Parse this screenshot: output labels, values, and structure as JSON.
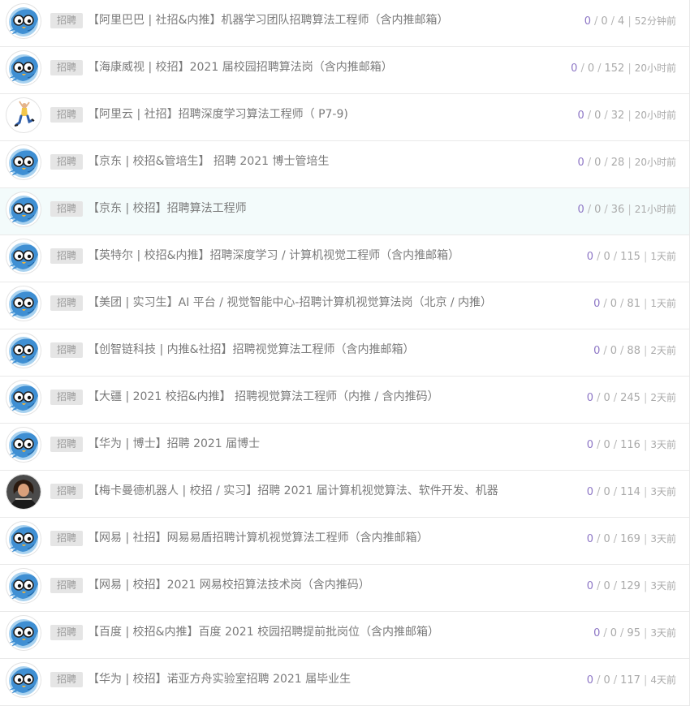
{
  "topics": [
    {
      "tag": "招聘",
      "title": "【阿里巴巴 | 社招&内推】机器学习团队招聘算法工程师（含内推邮箱）",
      "replies": "0",
      "likes": "0",
      "views": "4",
      "time": "52分钟前",
      "avatar": "bird-avatar-icon"
    },
    {
      "tag": "招聘",
      "title": "【海康威视 | 校招】2021 届校园招聘算法岗（含内推邮箱）",
      "replies": "0",
      "likes": "0",
      "views": "152",
      "time": "20小时前",
      "avatar": "bird-avatar-icon"
    },
    {
      "tag": "招聘",
      "title": "【阿里云 | 社招】招聘深度学习算法工程师（ P7-9)",
      "replies": "0",
      "likes": "0",
      "views": "32",
      "time": "20小时前",
      "avatar": "jumping-person-avatar-icon"
    },
    {
      "tag": "招聘",
      "title": "【京东 | 校招&管培生】 招聘 2021 博士管培生",
      "replies": "0",
      "likes": "0",
      "views": "28",
      "time": "20小时前",
      "avatar": "bird-avatar-icon"
    },
    {
      "tag": "招聘",
      "title": "【京东 | 校招】招聘算法工程师",
      "replies": "0",
      "likes": "0",
      "views": "36",
      "time": "21小时前",
      "avatar": "bird-avatar-icon"
    },
    {
      "tag": "招聘",
      "title": "【英特尔 | 校招&内推】招聘深度学习 / 计算机视觉工程师（含内推邮箱）",
      "replies": "0",
      "likes": "0",
      "views": "115",
      "time": "1天前",
      "avatar": "bird-avatar-icon"
    },
    {
      "tag": "招聘",
      "title": "【美团 | 实习生】AI 平台 / 视觉智能中心-招聘计算机视觉算法岗（北京 / 内推）",
      "replies": "0",
      "likes": "0",
      "views": "81",
      "time": "1天前",
      "avatar": "bird-avatar-icon"
    },
    {
      "tag": "招聘",
      "title": "【创智链科技 | 内推&社招】招聘视觉算法工程师（含内推邮箱）",
      "replies": "0",
      "likes": "0",
      "views": "88",
      "time": "2天前",
      "avatar": "bird-avatar-icon"
    },
    {
      "tag": "招聘",
      "title": "【大疆 | 2021 校招&内推】 招聘视觉算法工程师（内推 / 含内推码）",
      "replies": "0",
      "likes": "0",
      "views": "245",
      "time": "2天前",
      "avatar": "bird-avatar-icon"
    },
    {
      "tag": "招聘",
      "title": "【华为 | 博士】招聘 2021 届博士",
      "replies": "0",
      "likes": "0",
      "views": "116",
      "time": "3天前",
      "avatar": "bird-avatar-icon"
    },
    {
      "tag": "招聘",
      "title": "【梅卡曼德机器人 | 校招 / 实习】招聘 2021 届计算机视觉算法、软件开发、机器",
      "replies": "0",
      "likes": "0",
      "views": "114",
      "time": "3天前",
      "avatar": "person-photo-avatar-icon"
    },
    {
      "tag": "招聘",
      "title": "【网易 | 社招】网易易盾招聘计算机视觉算法工程师（含内推邮箱）",
      "replies": "0",
      "likes": "0",
      "views": "169",
      "time": "3天前",
      "avatar": "bird-avatar-icon"
    },
    {
      "tag": "招聘",
      "title": "【网易 | 校招】2021 网易校招算法技术岗（含内推码）",
      "replies": "0",
      "likes": "0",
      "views": "129",
      "time": "3天前",
      "avatar": "bird-avatar-icon"
    },
    {
      "tag": "招聘",
      "title": "【百度 | 校招&内推】百度 2021 校园招聘提前批岗位（含内推邮箱）",
      "replies": "0",
      "likes": "0",
      "views": "95",
      "time": "3天前",
      "avatar": "bird-avatar-icon"
    },
    {
      "tag": "招聘",
      "title": "【华为 | 校招】诺亚方舟实验室招聘 2021 届毕业生",
      "replies": "0",
      "likes": "0",
      "views": "117",
      "time": "4天前",
      "avatar": "bird-avatar-icon"
    }
  ],
  "separator": "/",
  "divider": "|",
  "colors": {
    "replies": "#8d76c5",
    "highlight_row": "#f3fbfb",
    "tag_bg": "#e5e5e5"
  }
}
